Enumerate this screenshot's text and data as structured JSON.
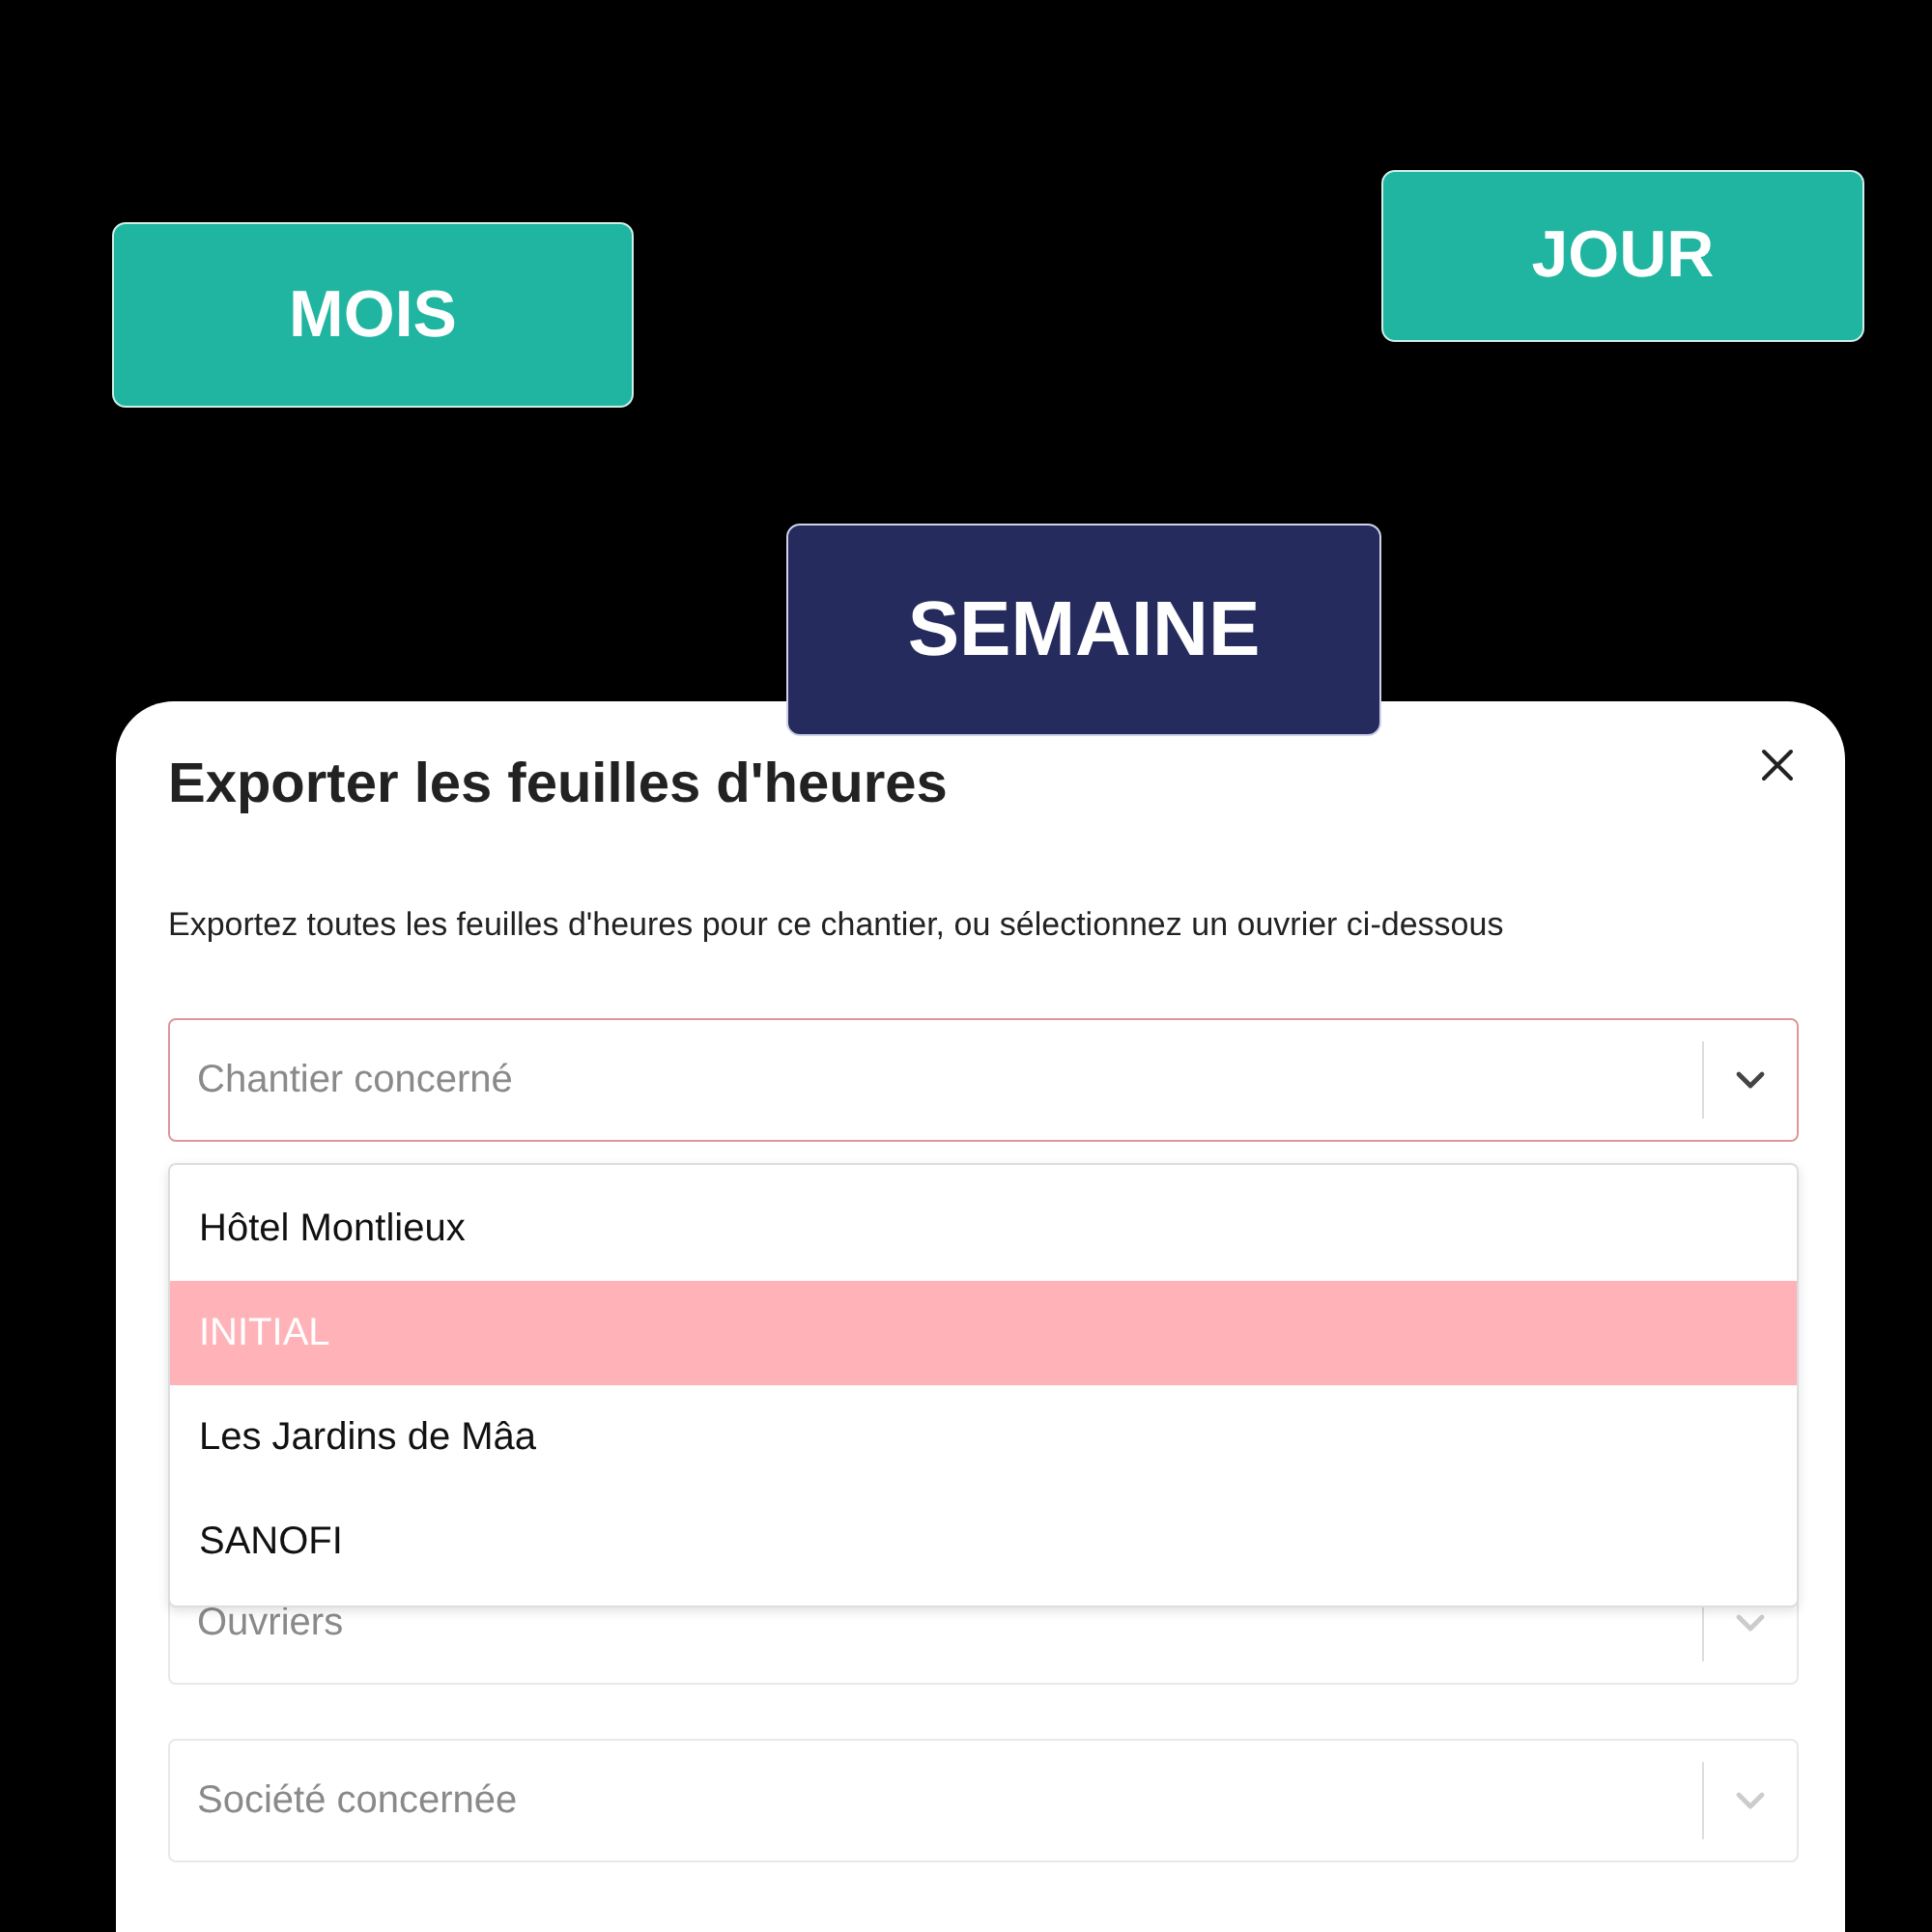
{
  "period_buttons": [
    {
      "label": "MOIS",
      "selected": false
    },
    {
      "label": "JOUR",
      "selected": false
    },
    {
      "label": "SEMAINE",
      "selected": true
    }
  ],
  "dialog": {
    "title": "Exporter les feuilles d'heures",
    "description": "Exportez toutes les feuilles d'heures pour ce chantier, ou sélectionnez un ouvrier ci-dessous",
    "selects": [
      {
        "placeholder": "Chantier concerné",
        "open": true,
        "options": [
          {
            "label": "Hôtel Montlieux",
            "selected": false
          },
          {
            "label": "INITIAL",
            "selected": true
          },
          {
            "label": "Les Jardins de Mâa",
            "selected": false
          },
          {
            "label": "SANOFI",
            "selected": false
          }
        ]
      },
      {
        "placeholder": "Ouvriers",
        "open": false
      },
      {
        "placeholder": "Société concernée",
        "open": false
      }
    ]
  }
}
